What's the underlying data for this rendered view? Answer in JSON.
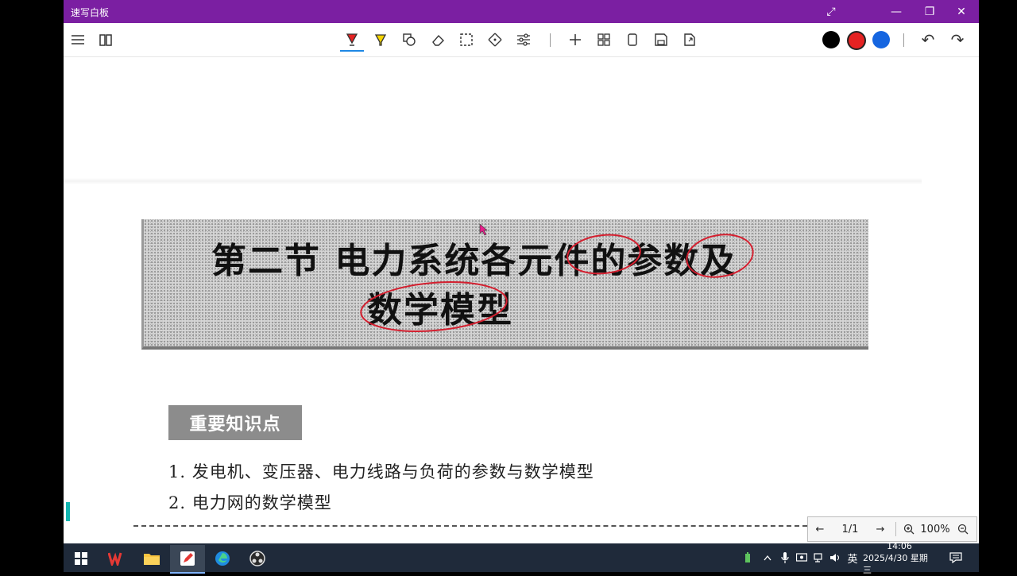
{
  "window": {
    "title": "速写白板",
    "controls": {
      "fullscreen": "⤢",
      "minimize": "—",
      "restore": "❐",
      "close": "✕"
    }
  },
  "toolbar": {
    "tools": [
      "menu-icon",
      "book-icon",
      "pen-icon",
      "highlighter-icon",
      "shape-icon",
      "eraser-icon",
      "select-icon",
      "move-icon",
      "settings-sliders-icon",
      "add-icon",
      "grid-icon",
      "page-icon",
      "save-icon",
      "export-icon"
    ],
    "colors": [
      "#000000",
      "#e52222",
      "#1565e0"
    ],
    "selected_color": "#e52222",
    "history": {
      "undo": "↶",
      "redo": "↷"
    }
  },
  "document": {
    "section_title_line1": "第二节  电力系统各元件的参数及",
    "section_title_line2": "数学模型",
    "annotation_color": "#d41f2f",
    "key_points_label": "重要知识点",
    "points": [
      "1. 发电机、变压器、电力线路与负荷的参数与数学模型",
      "2. 电力网的数学模型"
    ]
  },
  "pager": {
    "prev": "←",
    "page": "1/1",
    "next": "→",
    "zoom": "100%"
  },
  "taskbar": {
    "apps": [
      "windows-start-icon",
      "wps-icon",
      "file-explorer-icon",
      "whiteboard-app-icon",
      "edge-icon",
      "obs-icon"
    ],
    "ime": "英",
    "time": "14:06",
    "date": "2025/4/30 星期三"
  }
}
